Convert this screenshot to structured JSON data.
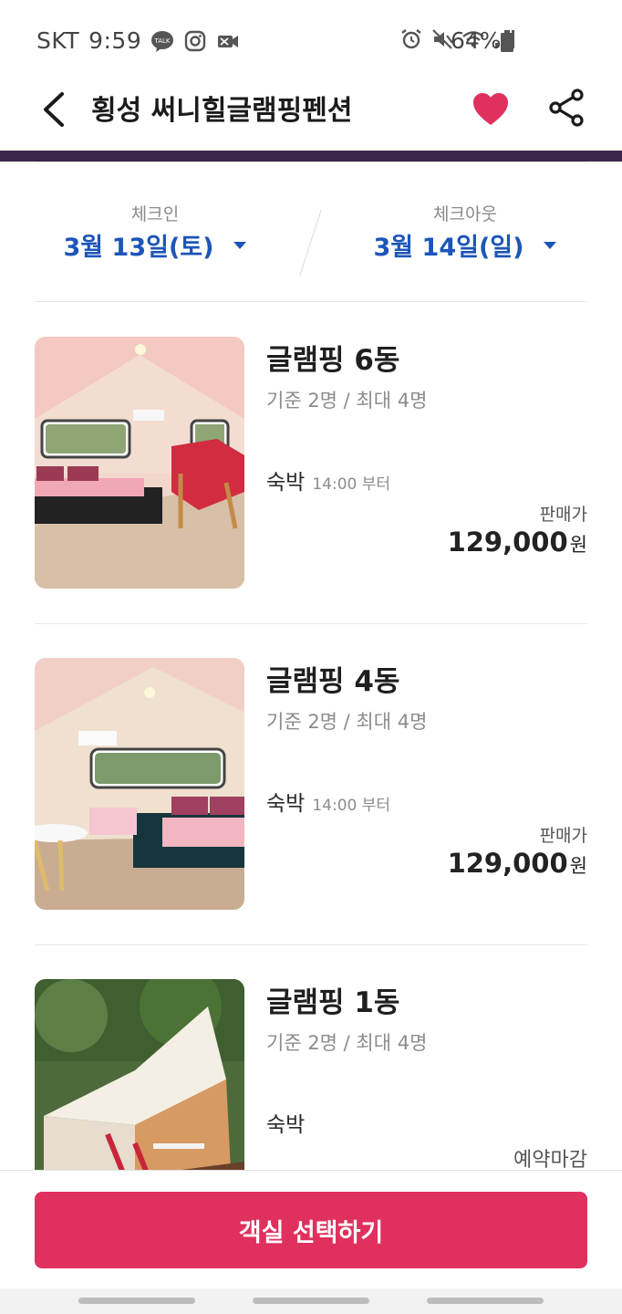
{
  "status_bar": {
    "carrier": "SKT",
    "time": "9:59",
    "battery": "64%",
    "left_icons": [
      "kakaotalk-icon",
      "instagram-icon",
      "video-call-icon"
    ],
    "right_icons": [
      "alarm-icon",
      "mute-icon",
      "wifi-icon",
      "signal-icon",
      "battery-icon"
    ]
  },
  "header": {
    "title": "횡성 써니힐글램핑펜션",
    "favorite_color": "#e0305d"
  },
  "dates": {
    "checkin_label": "체크인",
    "checkin_value": "3월 13일(토)",
    "checkout_label": "체크아웃",
    "checkout_value": "3월 14일(일)",
    "accent_color": "#1d55b8"
  },
  "rooms": [
    {
      "name": "글램핑 6동",
      "capacity": "기준 2명 / 최대 4명",
      "stay_label": "숙박",
      "stay_time": "14:00 부터",
      "price_label": "판매가",
      "price": "129,000",
      "price_unit": "원"
    },
    {
      "name": "글램핑 4동",
      "capacity": "기준 2명 / 최대 4명",
      "stay_label": "숙박",
      "stay_time": "14:00 부터",
      "price_label": "판매가",
      "price": "129,000",
      "price_unit": "원"
    },
    {
      "name": "글램핑 1동",
      "capacity": "기준 2명 / 최대 4명",
      "stay_label": "숙박",
      "status": "예약마감"
    }
  ],
  "bottom": {
    "select_button": "객실 선택하기",
    "button_color": "#e0305d"
  }
}
